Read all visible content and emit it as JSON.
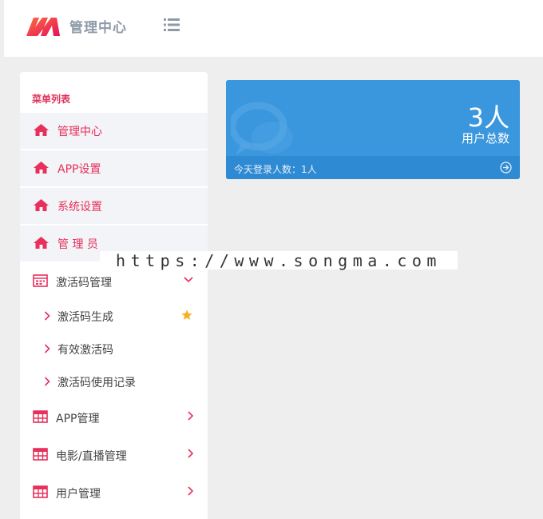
{
  "header": {
    "brand": "管理中心",
    "logo_icon": "brand-logo-icon",
    "menu_toggle_icon": "list-menu-icon"
  },
  "sidebar": {
    "title": "菜单列表",
    "items": [
      {
        "label": "管理中心",
        "icon": "home-icon"
      },
      {
        "label": "APP设置",
        "icon": "home-icon"
      },
      {
        "label": "系统设置",
        "icon": "home-icon"
      },
      {
        "label": "管 理 员",
        "icon": "home-icon"
      }
    ],
    "groups": [
      {
        "label": "激活码管理",
        "icon": "calendar-icon",
        "expanded": true,
        "children": [
          {
            "label": "激活码生成",
            "starred": true
          },
          {
            "label": "有效激活码"
          },
          {
            "label": "激活码使用记录"
          }
        ]
      },
      {
        "label": "APP管理",
        "icon": "table-icon"
      },
      {
        "label": "电影/直播管理",
        "icon": "table-icon"
      },
      {
        "label": "用户管理",
        "icon": "table-icon"
      }
    ]
  },
  "watermark": "https://www.songma.com",
  "stat_card": {
    "value": "3人",
    "label": "用户总数",
    "footer": "今天登录人数：1人"
  },
  "colors": {
    "accent": "#e8305c",
    "card_blue": "#3a97dd",
    "card_footer": "#2e8ad3",
    "star": "#f5b324"
  }
}
